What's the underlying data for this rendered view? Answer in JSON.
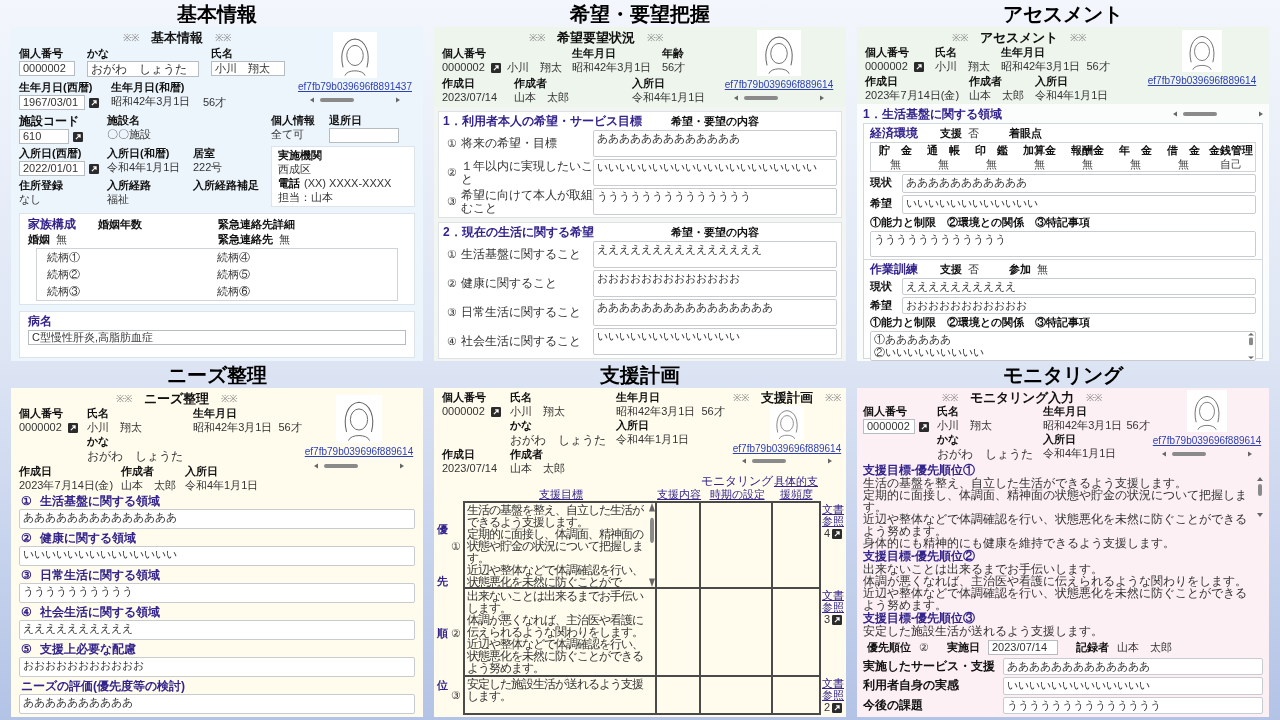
{
  "slide": {
    "panels": [
      {
        "kind": "basic_info",
        "caption": "基本情報",
        "screen": {
          "heading": {
            "marks_left": "※※",
            "title": "基本情報",
            "marks_right": "※※"
          },
          "photo_link": "ef7fb79b039696f8891437",
          "person_no": {
            "label": "個人番号",
            "value": "0000002"
          },
          "kana": {
            "label": "かな",
            "value": "おがわ　しょうた"
          },
          "name": {
            "label": "氏名",
            "value": "小川　翔太"
          },
          "birth": {
            "label": "生年月日(西暦)",
            "value": "1967/03/01"
          },
          "birth_era": {
            "label": "生年月日(和暦)",
            "value": "昭和42年3月1日"
          },
          "age": "56才",
          "facility_code": {
            "label": "施設コード",
            "value": "610"
          },
          "facility_name": {
            "label": "施設名",
            "value": "〇〇施設"
          },
          "privacy": {
            "label": "個人情報",
            "value": "全て可"
          },
          "leave_date": {
            "label": "退所日"
          },
          "admission": {
            "label": "入所日(西暦)",
            "value": "2022/01/01"
          },
          "admission_era": {
            "label": "入所日(和暦)",
            "value": "令和4年1月1日"
          },
          "room": {
            "label": "居室",
            "value": "222号"
          },
          "agency": {
            "title": "実施機関",
            "name": "西成区",
            "phone": {
              "label": "電話",
              "value": "(XX) XXXX-XXXX"
            },
            "contact": "担当：山本"
          },
          "address": {
            "label": "住所登録",
            "value": "なし"
          },
          "route": {
            "label": "入所経路",
            "value": "福祉"
          },
          "route_note": {
            "label": "入所経路補足"
          },
          "family": {
            "title": "家族構成",
            "marriage_years": "婚姻年数",
            "emergency_detail": "緊急連絡先詳細",
            "spouse": {
              "label": "婚姻",
              "value": "無"
            },
            "emergency": {
              "label": "緊急連絡先",
              "value": "無"
            },
            "relations": [
              "続柄①",
              "続柄②",
              "続柄③",
              "続柄④",
              "続柄⑤",
              "続柄⑥"
            ]
          },
          "disease": {
            "title": "病名",
            "value": "C型慢性肝炎,高脂肪血症"
          }
        }
      },
      {
        "kind": "wishes",
        "caption": "希望・要望把握",
        "screen": {
          "heading": {
            "marks_left": "※※",
            "title": "希望要望状況",
            "marks_right": "※※"
          },
          "photo_link": "ef7fb79b039696f889614",
          "person_no": {
            "label": "個人番号",
            "value": "0000002"
          },
          "name_value": "小川　翔太",
          "birth": {
            "label": "生年月日",
            "value": "昭和42年3月1日"
          },
          "age": {
            "label": "年齢",
            "value": "56才"
          },
          "created": {
            "label": "作成日",
            "value": "2023/07/14"
          },
          "author": {
            "label": "作成者",
            "value": "山本　太郎"
          },
          "admission": {
            "label": "入所日",
            "value": "令和4年1月1日"
          },
          "sections": [
            {
              "title": "1．利用者本人の希望・サービス目標",
              "column": "希望・要望の内容",
              "items": [
                {
                  "no": "①",
                  "label": "将来の希望・目標",
                  "value": "あああああああああああああ"
                },
                {
                  "no": "②",
                  "label": "１年以内に実現したいこと",
                  "value": "いいいいいいいいいいいいいいいいいいいい"
                },
                {
                  "no": "③",
                  "label": "希望に向けて本人が取組むこと",
                  "value": "うううううううううううううう"
                }
              ]
            },
            {
              "title": "2．現在の生活に関する希望",
              "column": "希望・要望の内容",
              "items": [
                {
                  "no": "①",
                  "label": "生活基盤に関すること",
                  "value": "えええええええええええええええ"
                },
                {
                  "no": "②",
                  "label": "健康に関すること",
                  "value": "おおおおおおおおおおおおお"
                },
                {
                  "no": "③",
                  "label": "日常生活に関すること",
                  "value": "ああああああああああああああああ"
                },
                {
                  "no": "④",
                  "label": "社会生活に関すること",
                  "value": "いいいいいいいいいいいいい"
                }
              ]
            }
          ]
        }
      },
      {
        "kind": "assessment",
        "caption": "アセスメント",
        "screen": {
          "heading": {
            "marks_left": "※※",
            "title": "アセスメント",
            "marks_right": "※※"
          },
          "photo_link": "ef7fb79b039696f889614",
          "person_no": {
            "label": "個人番号",
            "value": "0000002"
          },
          "name": {
            "label": "氏名",
            "value": "小川　翔太"
          },
          "birth": {
            "label": "生年月日",
            "value": "昭和42年3月1日"
          },
          "age": "56才",
          "created": {
            "label": "作成日",
            "value": "2023年7月14日(金)"
          },
          "author": {
            "label": "作成者",
            "value": "山本　太郎"
          },
          "admission": {
            "label": "入所日",
            "value": "令和4年1月1日"
          },
          "section_title": "1．生活基盤に関する領域",
          "groups": [
            {
              "kind": "table",
              "title": "経済環境",
              "support": {
                "label": "支援",
                "value": "否"
              },
              "focus_label": "着眼点",
              "columns": [
                "貯　金",
                "通　帳",
                "印　鑑",
                "加算金",
                "報酬金",
                "年　金",
                "借　金",
                "金銭管理"
              ],
              "values": [
                "無",
                "無",
                "無",
                "無",
                "無",
                "無",
                "無",
                "自己"
              ],
              "fields": [
                {
                  "label": "現状",
                  "lines": [
                    "あああああああああああ"
                  ],
                  "scrollable": false
                },
                {
                  "label": "希望",
                  "lines": [
                    "いいいいいいいいいいいい"
                  ],
                  "scrollable": false
                },
                {
                  "label": "①能力と制限　②環境との関係　③特記事項",
                  "lines": [
                    "うううううううううううう"
                  ],
                  "scrollable": false
                }
              ]
            },
            {
              "kind": "participation",
              "title": "作業訓練",
              "support": {
                "label": "支援",
                "value": "否"
              },
              "participation": {
                "label": "参加",
                "value": "無"
              },
              "fields": [
                {
                  "label": "現状",
                  "lines": [
                    "ええええええええええ"
                  ],
                  "scrollable": false
                },
                {
                  "label": "希望",
                  "lines": [
                    "おおおおおおおおおおお"
                  ],
                  "scrollable": false
                },
                {
                  "label": "①能力と制限　②環境との関係　③特記事項",
                  "lines": [
                    "①ああああああ",
                    "②いいいいいいいいい"
                  ],
                  "scrollable": true
                }
              ]
            }
          ]
        }
      },
      {
        "kind": "needs",
        "caption": "ニーズ整理",
        "screen": {
          "heading": {
            "marks_left": "※※",
            "title": "ニーズ整理",
            "marks_right": "※※"
          },
          "photo_link": "ef7fb79b039696f889614",
          "person_no": {
            "label": "個人番号",
            "value": "0000002"
          },
          "name": {
            "label": "氏名",
            "value": "小川　翔太"
          },
          "kana": {
            "label": "かな",
            "value": "おがわ　しょうた"
          },
          "birth": {
            "label": "生年月日",
            "value": "昭和42年3月1日"
          },
          "age": "56才",
          "created": {
            "label": "作成日",
            "value": "2023年7月14日(金)"
          },
          "author": {
            "label": "作成者",
            "value": "山本　太郎"
          },
          "admission": {
            "label": "入所日",
            "value": "令和4年1月1日"
          },
          "areas": [
            {
              "no": "①",
              "label": "生活基盤に関する領域",
              "value": "ああああああああああああああ"
            },
            {
              "no": "②",
              "label": "健康に関する領域",
              "value": "いいいいいいいいいいいいいい"
            },
            {
              "no": "③",
              "label": "日常生活に関する領域",
              "value": "うううううううううう"
            },
            {
              "no": "④",
              "label": "社会生活に関する領域",
              "value": "ええええええええええ"
            },
            {
              "no": "⑤",
              "label": "支援上必要な配慮",
              "value": "おおおおおおおおおおお"
            },
            {
              "label": "ニーズの評価(優先度等の検討)",
              "value": "ああああああああああ"
            }
          ]
        }
      },
      {
        "kind": "support_plan",
        "caption": "支援計画",
        "screen": {
          "heading": {
            "marks_left": "※※",
            "title": "支援計画",
            "marks_right": "※※"
          },
          "photo_link": "ef7fb79b039696f889614",
          "person_no": {
            "label": "個人番号",
            "value": "0000002"
          },
          "name": {
            "label": "氏名",
            "value": "小川　翔太"
          },
          "kana": {
            "label": "かな",
            "value": "おがわ　しょうた"
          },
          "birth": {
            "label": "生年月日",
            "value": "昭和42年3月1日"
          },
          "age": "56才",
          "admission": {
            "label": "入所日",
            "value": "令和4年1月1日"
          },
          "created": {
            "label": "作成日",
            "value": "2023/07/14"
          },
          "author": {
            "label": "作成者",
            "value": "山本　太郎"
          },
          "priority_label": "優先順位",
          "columns": [
            {
              "label": "支援目標"
            },
            {
              "label": "支援内容"
            },
            {
              "above": "モニタリング",
              "label": "時期の設定"
            },
            {
              "label": "具体的支援頻度"
            }
          ],
          "rows": [
            {
              "no": "①",
              "goal": [
                "生活の基盤を整え、自立した生活ができるよう支援します。",
                "定期的に面接し、体調面、精神面の状態や貯金の状況について把握します。",
                "近辺や整体などで体調確認を行い、状態悪化を未然に防ぐことがで"
              ],
              "scrollable": true,
              "doc": {
                "label": "文書参照",
                "count": "4"
              }
            },
            {
              "no": "②",
              "goal": [
                "出来ないことは出来るまでお手伝いします。",
                "体調が悪くなれば、主治医や看護に伝えられるような関わりをします。",
                "近辺や整体などで体調確認を行い、状態悪化を未然に防ぐことができるよう努めます。"
              ],
              "scrollable": false,
              "doc": {
                "label": "文書参照",
                "count": "3"
              }
            },
            {
              "no": "③",
              "goal": [
                "安定した施設生活が送れるよう支援します。"
              ],
              "scrollable": false,
              "doc": {
                "label": "文書参照",
                "count": "2"
              }
            }
          ]
        }
      },
      {
        "kind": "monitoring",
        "caption": "モニタリング",
        "screen": {
          "heading": {
            "marks_left": "※※",
            "title": "モニタリング入力",
            "marks_right": "※※"
          },
          "photo_link": "ef7fb79b039696f889614",
          "person_no": {
            "label": "個人番号",
            "value": "0000002"
          },
          "name": {
            "label": "氏名",
            "value": "小川　翔太"
          },
          "kana": {
            "label": "かな",
            "value": "おがわ　しょうた"
          },
          "birth": {
            "label": "生年月日",
            "value": "昭和42年3月1日"
          },
          "age": "56才",
          "admission": {
            "label": "入所日",
            "value": "令和4年1月1日"
          },
          "goals": [
            {
              "title": "支援目標-優先順位①",
              "lines": [
                "生活の基盤を整え、自立した生活ができるよう支援します。",
                "定期的に面接し、体調面、精神面の状態や貯金の状況について把握します。",
                "近辺や整体などで体調確認を行い、状態悪化を未然に防ぐことができるよう努めます。",
                "身体的にも精神的にも健康を維持できるよう支援します。"
              ]
            },
            {
              "title": "支援目標-優先順位②",
              "lines": [
                "出来ないことは出来るまでお手伝いします。",
                "体調が悪くなれば、主治医や看護に伝えられるような関わりをします。",
                "近辺や整体などで体調確認を行い、状態悪化を未然に防ぐことができるよう努めます。"
              ]
            },
            {
              "title": "支援目標-優先順位③",
              "lines": [
                "安定した施設生活が送れるよう支援します。"
              ]
            }
          ],
          "priority": {
            "label": "優先順位",
            "value": "②"
          },
          "date": {
            "label": "実施日",
            "value": "2023/07/14"
          },
          "recorder": {
            "label": "記録者",
            "value": "山本　太郎"
          },
          "records": [
            {
              "label": "実施したサービス・支援",
              "value": "あああああああああああああ"
            },
            {
              "label": "利用者自身の実感",
              "value": "いいいいいいいいいいいいい"
            },
            {
              "label": "今後の課題",
              "value": "うううううううううううううう"
            }
          ]
        }
      }
    ]
  }
}
